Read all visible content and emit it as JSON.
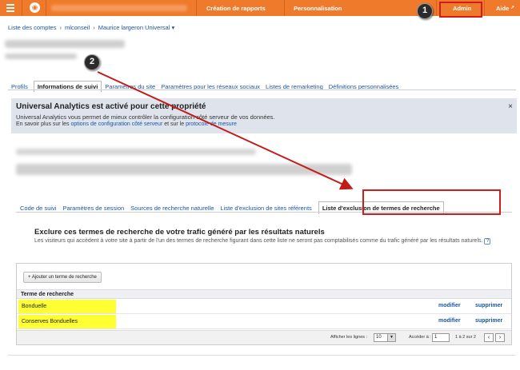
{
  "topbar": {
    "nav": [
      "Création de rapports",
      "Personnalisation",
      "Admin",
      "Aide"
    ],
    "help_icon": "external-link-icon"
  },
  "annotations": {
    "badge1": "1",
    "badge2": "2"
  },
  "breadcrumb": {
    "items": [
      "Liste des comptes",
      "mlconseil",
      "Maurice largeron Universal"
    ]
  },
  "property_tabs": [
    "Profils",
    "Informations de suivi",
    "Paramètres du site",
    "Paramètres pour les réseaux sociaux",
    "Listes de remarketing",
    "Définitions personnalisées"
  ],
  "notice": {
    "title": "Universal Analytics est activé pour cette propriété",
    "line1": "Universal Analytics vous permet de mieux contrôler la configuration côté serveur de vos données.",
    "line2_prefix": "En savoir plus sur les ",
    "link1": "options de configuration côté serveur",
    "line2_mid": " et sur le ",
    "link2": "protocole de mesure",
    "close": "×"
  },
  "tracking_tabs": [
    "Code de suivi",
    "Paramètres de session",
    "Sources de recherche naturelle",
    "Liste d'exclusion de sites référents",
    "Liste d'exclusion de termes de recherche"
  ],
  "section": {
    "title": "Exclure ces termes de recherche de votre trafic généré par les résultats naturels",
    "description": "Les visiteurs qui accèdent à votre site à partir de l'un des termes de recherche figurant dans cette liste ne seront pas comptabilisés comme du trafic généré par les résultats naturels.",
    "help": "?"
  },
  "table": {
    "add_button": "+ Ajouter un terme de recherche",
    "column": "Terme de recherche",
    "rows": [
      {
        "term": "Bonduelle",
        "edit": "modifier",
        "delete": "supprimer"
      },
      {
        "term": "Conserves Bonduelles",
        "edit": "modifier",
        "delete": "supprimer"
      }
    ]
  },
  "pager": {
    "rows_label": "Afficher les lignes :",
    "rows_value": "10",
    "goto_label": "Accéder à :",
    "goto_value": "1",
    "range": "1 à 2 sur 2",
    "prev": "‹",
    "next": "›"
  },
  "colors": {
    "topbar": "#f07a2b",
    "highlight": "#ffff33",
    "annotation_red": "#d01c1c",
    "link": "#1a56a8"
  }
}
